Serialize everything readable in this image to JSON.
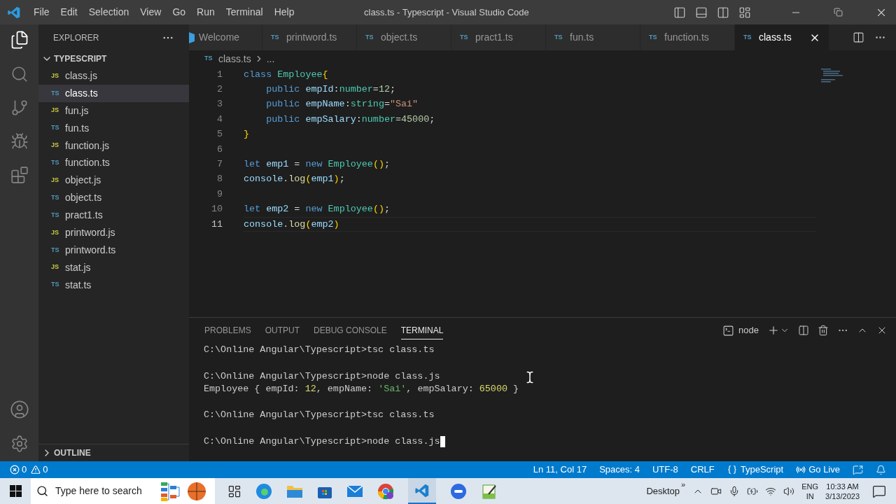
{
  "menu": [
    "File",
    "Edit",
    "Selection",
    "View",
    "Go",
    "Run",
    "Terminal",
    "Help"
  ],
  "window": {
    "title": "class.ts - Typescript - Visual Studio Code"
  },
  "explorer": {
    "title": "EXPLORER",
    "folder": "TYPESCRIPT",
    "expanded": true,
    "files": [
      {
        "name": "class.js",
        "kind": "js",
        "badge": "JS",
        "selected": false
      },
      {
        "name": "class.ts",
        "kind": "ts",
        "badge": "TS",
        "selected": true
      },
      {
        "name": "fun.js",
        "kind": "js",
        "badge": "JS",
        "selected": false
      },
      {
        "name": "fun.ts",
        "kind": "ts",
        "badge": "TS",
        "selected": false
      },
      {
        "name": "function.js",
        "kind": "js",
        "badge": "JS",
        "selected": false
      },
      {
        "name": "function.ts",
        "kind": "ts",
        "badge": "TS",
        "selected": false
      },
      {
        "name": "object.js",
        "kind": "js",
        "badge": "JS",
        "selected": false
      },
      {
        "name": "object.ts",
        "kind": "ts",
        "badge": "TS",
        "selected": false
      },
      {
        "name": "pract1.ts",
        "kind": "ts",
        "badge": "TS",
        "selected": false
      },
      {
        "name": "printword.js",
        "kind": "js",
        "badge": "JS",
        "selected": false
      },
      {
        "name": "printword.ts",
        "kind": "ts",
        "badge": "TS",
        "selected": false
      },
      {
        "name": "stat.js",
        "kind": "js",
        "badge": "JS",
        "selected": false
      },
      {
        "name": "stat.ts",
        "kind": "ts",
        "badge": "TS",
        "selected": false
      }
    ],
    "outline": "OUTLINE"
  },
  "tabs": [
    {
      "label": "Welcome",
      "kind": "welcome",
      "selected": false
    },
    {
      "label": "printword.ts",
      "kind": "ts",
      "badge": "TS",
      "selected": false
    },
    {
      "label": "object.ts",
      "kind": "ts",
      "badge": "TS",
      "selected": false
    },
    {
      "label": "pract1.ts",
      "kind": "ts",
      "badge": "TS",
      "selected": false
    },
    {
      "label": "fun.ts",
      "kind": "ts",
      "badge": "TS",
      "selected": false
    },
    {
      "label": "function.ts",
      "kind": "ts",
      "badge": "TS",
      "selected": false
    },
    {
      "label": "class.ts",
      "kind": "ts",
      "badge": "TS",
      "selected": true
    }
  ],
  "breadcrumb": {
    "kind": "ts",
    "badge": "TS",
    "file": "class.ts",
    "rest": "..."
  },
  "code": [
    {
      "number": "1",
      "active": false,
      "tokens": [
        {
          "text": "class ",
          "kind": "keyword"
        },
        {
          "text": "Employee",
          "kind": "type"
        },
        {
          "text": "{",
          "kind": "bracket"
        }
      ]
    },
    {
      "number": "2",
      "active": false,
      "tokens": [
        {
          "text": "    public ",
          "kind": "keyword"
        },
        {
          "text": "empId",
          "kind": "name"
        },
        {
          "text": ":",
          "kind": "punct"
        },
        {
          "text": "number",
          "kind": "type"
        },
        {
          "text": "=",
          "kind": "punct"
        },
        {
          "text": "12",
          "kind": "number"
        },
        {
          "text": ";",
          "kind": "punct"
        }
      ]
    },
    {
      "number": "3",
      "active": false,
      "tokens": [
        {
          "text": "    public ",
          "kind": "keyword"
        },
        {
          "text": "empName",
          "kind": "name"
        },
        {
          "text": ":",
          "kind": "punct"
        },
        {
          "text": "string",
          "kind": "type"
        },
        {
          "text": "=",
          "kind": "punct"
        },
        {
          "text": "\"Sai\"",
          "kind": "string"
        }
      ]
    },
    {
      "number": "4",
      "active": false,
      "tokens": [
        {
          "text": "    public ",
          "kind": "keyword"
        },
        {
          "text": "empSalary",
          "kind": "name"
        },
        {
          "text": ":",
          "kind": "punct"
        },
        {
          "text": "number",
          "kind": "type"
        },
        {
          "text": "=",
          "kind": "punct"
        },
        {
          "text": "45000",
          "kind": "number"
        },
        {
          "text": ";",
          "kind": "punct"
        }
      ]
    },
    {
      "number": "5",
      "active": false,
      "tokens": [
        {
          "text": "}",
          "kind": "bracket"
        }
      ]
    },
    {
      "number": "6",
      "active": false
    },
    {
      "number": "7",
      "active": false,
      "tokens": [
        {
          "text": "let ",
          "kind": "keyword"
        },
        {
          "text": "emp1",
          "kind": "name"
        },
        {
          "text": " = ",
          "kind": "punct"
        },
        {
          "text": "new ",
          "kind": "keyword"
        },
        {
          "text": "Employee",
          "kind": "type"
        },
        {
          "text": "()",
          "kind": "bracket"
        },
        {
          "text": ";",
          "kind": "punct"
        }
      ]
    },
    {
      "number": "8",
      "active": false,
      "tokens": [
        {
          "text": "console",
          "kind": "name"
        },
        {
          "text": ".",
          "kind": "punct"
        },
        {
          "text": "log",
          "kind": "func"
        },
        {
          "text": "(",
          "kind": "bracket"
        },
        {
          "text": "emp1",
          "kind": "name"
        },
        {
          "text": ")",
          "kind": "bracket"
        },
        {
          "text": ";",
          "kind": "punct"
        }
      ]
    },
    {
      "number": "9",
      "active": false
    },
    {
      "number": "10",
      "active": false,
      "tokens": [
        {
          "text": "let ",
          "kind": "keyword"
        },
        {
          "text": "emp2",
          "kind": "name"
        },
        {
          "text": " = ",
          "kind": "punct"
        },
        {
          "text": "new ",
          "kind": "keyword"
        },
        {
          "text": "Employee",
          "kind": "type"
        },
        {
          "text": "()",
          "kind": "bracket"
        },
        {
          "text": ";",
          "kind": "punct"
        }
      ]
    },
    {
      "number": "11",
      "active": true,
      "tokens": [
        {
          "text": "console",
          "kind": "name"
        },
        {
          "text": ".",
          "kind": "punct"
        },
        {
          "text": "log",
          "kind": "func"
        },
        {
          "text": "(",
          "kind": "bracket"
        },
        {
          "text": "emp2",
          "kind": "name"
        },
        {
          "text": ")",
          "kind": "bracket"
        }
      ]
    }
  ],
  "panel": {
    "tabs": [
      {
        "label": "PROBLEMS",
        "selected": false
      },
      {
        "label": "OUTPUT",
        "selected": false
      },
      {
        "label": "DEBUG CONSOLE",
        "selected": false
      },
      {
        "label": "TERMINAL",
        "selected": true
      }
    ],
    "shell": "node",
    "terminal": [
      {
        "command": "C:\\Online Angular\\Typescript>tsc class.ts"
      },
      {
        "command": "C:\\Online Angular\\Typescript>node class.js",
        "output": [
          {
            "text": "Employee { empId: ",
            "kind": "plain"
          },
          {
            "text": "12",
            "kind": "number"
          },
          {
            "text": ", empName: ",
            "kind": "plain"
          },
          {
            "text": "'Sai'",
            "kind": "string"
          },
          {
            "text": ", empSalary: ",
            "kind": "plain"
          },
          {
            "text": "65000",
            "kind": "number"
          },
          {
            "text": " }",
            "kind": "plain"
          }
        ]
      },
      {
        "command": "C:\\Online Angular\\Typescript>tsc class.ts"
      },
      {
        "command": "C:\\Online Angular\\Typescript>node class.js"
      }
    ]
  },
  "status_bar": {
    "errors": "0",
    "warnings": "0",
    "items": [
      "Ln 11, Col 17",
      "Spaces: 4",
      "UTF-8",
      "CRLF"
    ],
    "language": "TypeScript",
    "live": "Go Live"
  },
  "taskbar": {
    "search_placeholder": "Type here to search",
    "desktop": "Desktop",
    "chevrons": "»",
    "lang": "ENG",
    "region": "IN",
    "time": "10:33 AM",
    "date": "3/13/2023"
  }
}
